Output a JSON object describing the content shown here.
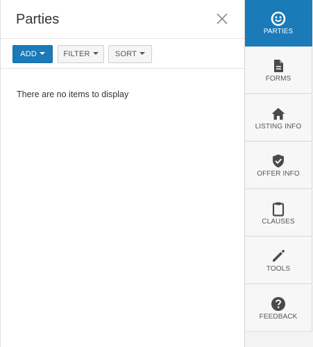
{
  "panel": {
    "title": "Parties",
    "empty_message": "There are no items to display"
  },
  "toolbar": {
    "add_label": "ADD",
    "filter_label": "FILTER",
    "sort_label": "SORT"
  },
  "rail": {
    "items": [
      {
        "label": "PARTIES",
        "icon": "smile-face-icon",
        "active": true
      },
      {
        "label": "FORMS",
        "icon": "document-icon",
        "active": false
      },
      {
        "label": "LISTING INFO",
        "icon": "home-icon",
        "active": false
      },
      {
        "label": "OFFER INFO",
        "icon": "shield-check-icon",
        "active": false
      },
      {
        "label": "CLAUSES",
        "icon": "clipboard-icon",
        "active": false
      },
      {
        "label": "TOOLS",
        "icon": "pencil-icon",
        "active": false
      },
      {
        "label": "FEEDBACK",
        "icon": "question-circle-icon",
        "active": false
      }
    ]
  },
  "colors": {
    "accent": "#1b7ab8",
    "rail_icon": "#4a4a4a"
  }
}
